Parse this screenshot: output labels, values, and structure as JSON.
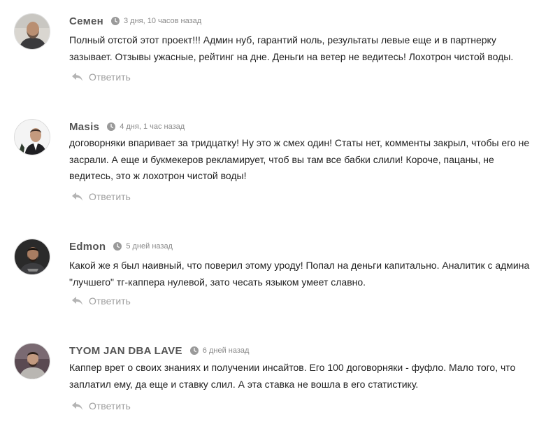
{
  "comments": [
    {
      "author": "Семен",
      "date": "3 дня, 10 часов назад",
      "text": "Полный отстой этот проект!!! Админ нуб, гарантий ноль, результаты левые еще и в партнерку зазывает. Отзывы ужасные, рейтинг на дне. Деньги на ветер не ведитесь! Лохотрон чистой воды.",
      "reply_label": "Ответить",
      "avatar_icon": "avatar-photo"
    },
    {
      "author": "Masis",
      "date": "4 дня, 1 час назад",
      "text": "договорняки впаривает за тридцатку! Ну это ж смех один! Статы нет, комменты закрыл, чтобы его не засрали. А еще и букмекеров рекламирует, чтоб вы там все бабки слили! Короче, пацаны, не ведитесь, это ж лохотрон чистой воды!",
      "reply_label": "Ответить",
      "avatar_icon": "avatar-photo"
    },
    {
      "author": "Edmon",
      "date": "5 дней назад",
      "text": "Какой же я был наивный, что поверил этому уроду! Попал на деньги капитально. Аналитик с админа \"лучшего\" тг-каппера нулевой, зато чесать языком умеет славно.",
      "reply_label": "Ответить",
      "avatar_icon": "avatar-photo"
    },
    {
      "author": "TYOM JAN DBA LAVE",
      "date": "6 дней назад",
      "text": "Каппер врет о своих знаниях и получении инсайтов. Его 100 договорняки - фуфло. Мало того, что заплатил ему, да еще и ставку слил. А эта ставка не вошла в его статистику.",
      "reply_label": "Ответить",
      "avatar_icon": "avatar-photo"
    }
  ],
  "colors": {
    "author": "#555555",
    "date": "#8a8a8a",
    "text": "#222222",
    "reply": "#a0a0a0"
  }
}
